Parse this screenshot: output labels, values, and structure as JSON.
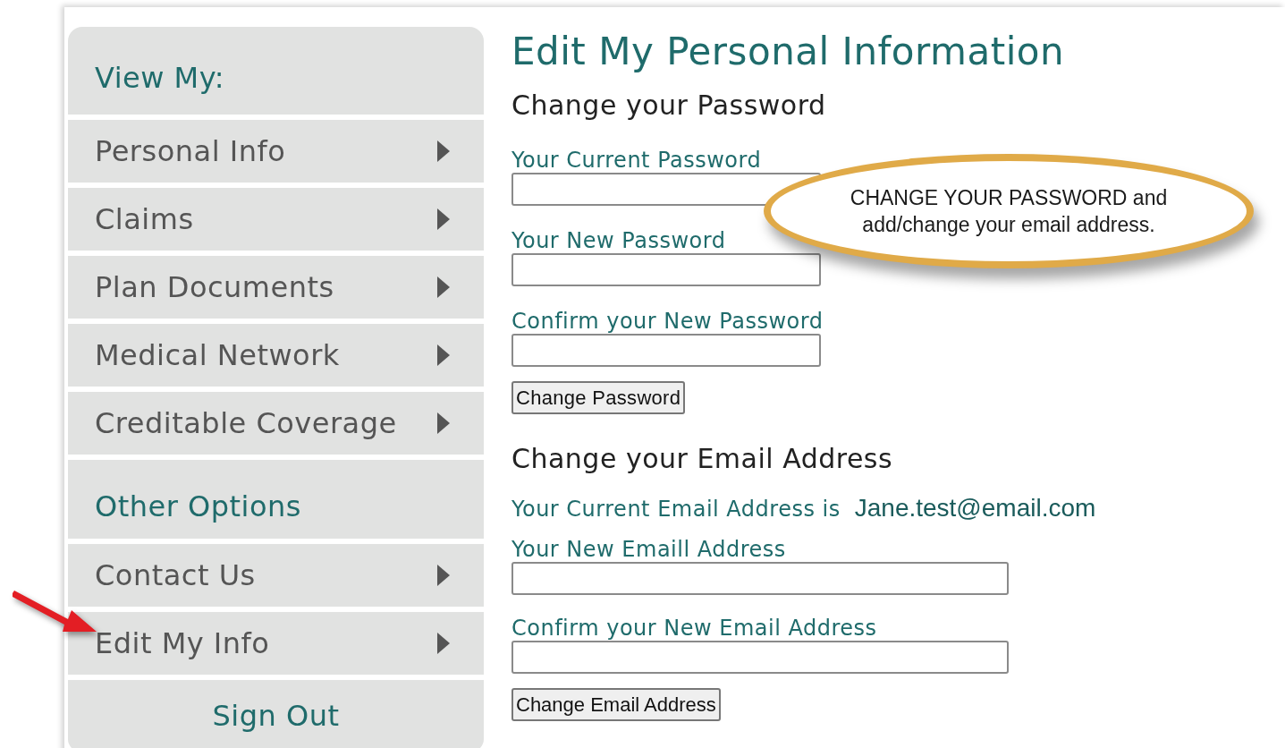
{
  "sidebar": {
    "items": [
      {
        "kind": "heading",
        "label": "View My:"
      },
      {
        "kind": "link",
        "label": "Personal Info"
      },
      {
        "kind": "link",
        "label": "Claims"
      },
      {
        "kind": "link",
        "label": "Plan Documents"
      },
      {
        "kind": "link",
        "label": "Medical Network"
      },
      {
        "kind": "link",
        "label": "Creditable Coverage"
      },
      {
        "kind": "heading",
        "label": "Other Options"
      },
      {
        "kind": "link",
        "label": "Contact Us"
      },
      {
        "kind": "link",
        "label": "Edit My Info"
      },
      {
        "kind": "action",
        "label": "Sign Out"
      }
    ]
  },
  "page_title": "Edit My Personal Information",
  "password_section": {
    "heading": "Change your Password",
    "fields": [
      {
        "label": "Your Current Password"
      },
      {
        "label": "Your New Password"
      },
      {
        "label": "Confirm your New Password"
      }
    ],
    "button": "Change Password"
  },
  "email_section": {
    "heading": "Change your Email Address",
    "current_label": "Your Current Email Address is",
    "current_value": "Jane.test@email.com",
    "fields": [
      {
        "label": "Your New Emaill Address"
      },
      {
        "label": "Confirm your New Email Address"
      }
    ],
    "button": "Change Email Address"
  },
  "callout": {
    "lines": [
      "CHANGE YOUR PASSWORD and",
      "add/change your email address."
    ]
  }
}
